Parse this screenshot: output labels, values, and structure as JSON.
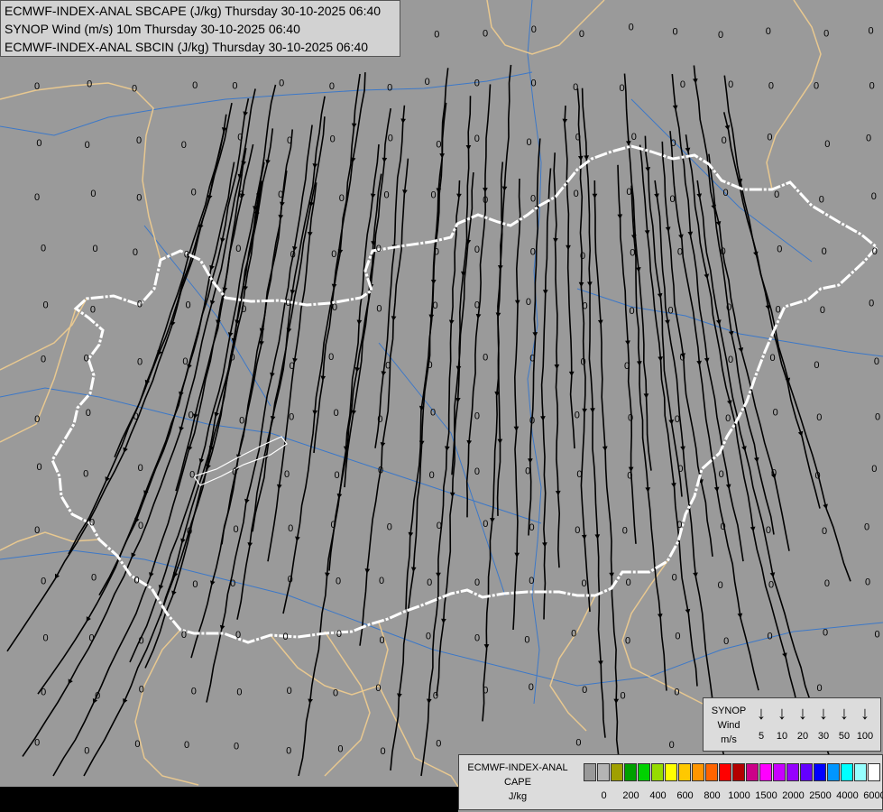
{
  "titles": {
    "line1": "ECMWF-INDEX-ANAL SBCAPE (J/kg) Thursday 30-10-2025 06:40",
    "line2": "SYNOP Wind (m/s) 10m Thursday 30-10-2025 06:40",
    "line3": "ECMWF-INDEX-ANAL SBCIN (J/kg) Thursday 30-10-2025 06:40"
  },
  "map": {
    "station_value": "0",
    "background_color": "#9a9a9a",
    "country_border_color": "#ffffff",
    "neighbour_border_color": "#e8c890",
    "river_color": "#3c78c8",
    "streamline_color": "#000000"
  },
  "wind_legend": {
    "title": [
      "SYNOP",
      "Wind",
      "m/s"
    ],
    "arrow_icon": "down-arrow-icon",
    "values": [
      "5",
      "10",
      "20",
      "30",
      "50",
      "100"
    ]
  },
  "cape_legend": {
    "title": [
      "ECMWF-INDEX-ANAL",
      "CAPE",
      "J/kg"
    ],
    "colors": [
      "#999999",
      "#b4b4b4",
      "#a0a000",
      "#00a000",
      "#00d200",
      "#96dc00",
      "#ffff00",
      "#ffc800",
      "#ff9600",
      "#ff6400",
      "#ff0000",
      "#b40000",
      "#cc0088",
      "#ff00ff",
      "#c800ff",
      "#9600ff",
      "#6400ff",
      "#0000ff",
      "#0096ff",
      "#00ffff",
      "#96ffff",
      "#ffffff"
    ],
    "ticks": [
      "0",
      "200",
      "400",
      "600",
      "800",
      "1000",
      "1500",
      "2000",
      "2500",
      "4000",
      "6000"
    ]
  }
}
